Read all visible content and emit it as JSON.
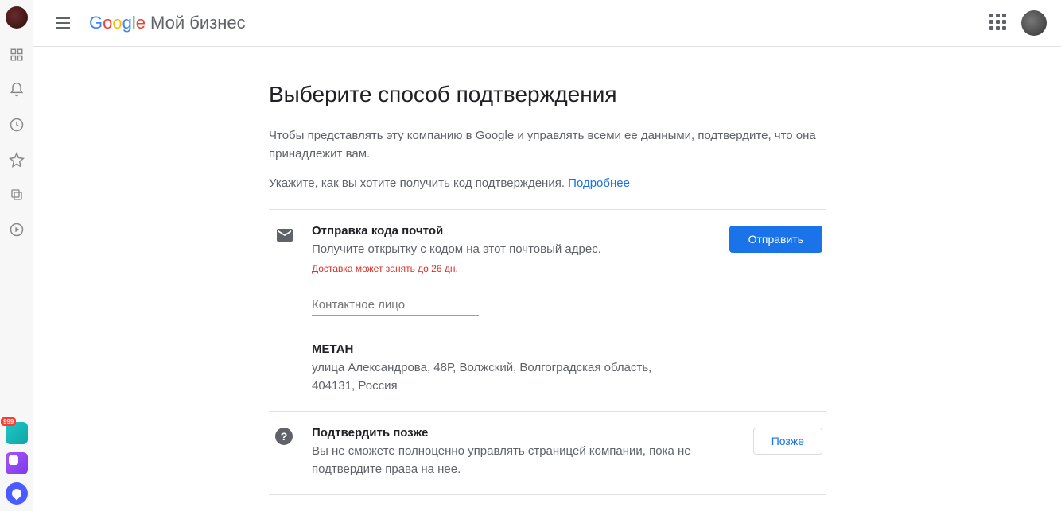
{
  "header": {
    "logo_letters": [
      "G",
      "o",
      "o",
      "g",
      "l",
      "e"
    ],
    "product_name": "Мой бизнес"
  },
  "os_sidebar": {
    "badge_count": "999"
  },
  "page": {
    "title": "Выберите способ подтверждения",
    "description": "Чтобы представлять эту компанию в Google и управлять всеми ее данными, подтвердите, что она принадлежит вам.",
    "instruction": "Укажите, как вы хотите получить код подтверждения.",
    "learn_more_label": "Подробнее"
  },
  "mail_option": {
    "title": "Отправка кода почтой",
    "description": "Получите открытку с кодом на этот почтовый адрес.",
    "delivery_warning": "Доставка может занять до 26 дн.",
    "contact_placeholder": "Контактное лицо",
    "contact_value": "",
    "business_name": "МЕТАН",
    "business_address": "улица Александрова, 48Р, Волжский, Волгоградская область, 404131, Россия",
    "send_button": "Отправить"
  },
  "later_option": {
    "title": "Подтвердить позже",
    "description": "Вы не сможете полноценно управлять страницей компании, пока не подтвердите права на нее.",
    "later_button": "Позже"
  }
}
